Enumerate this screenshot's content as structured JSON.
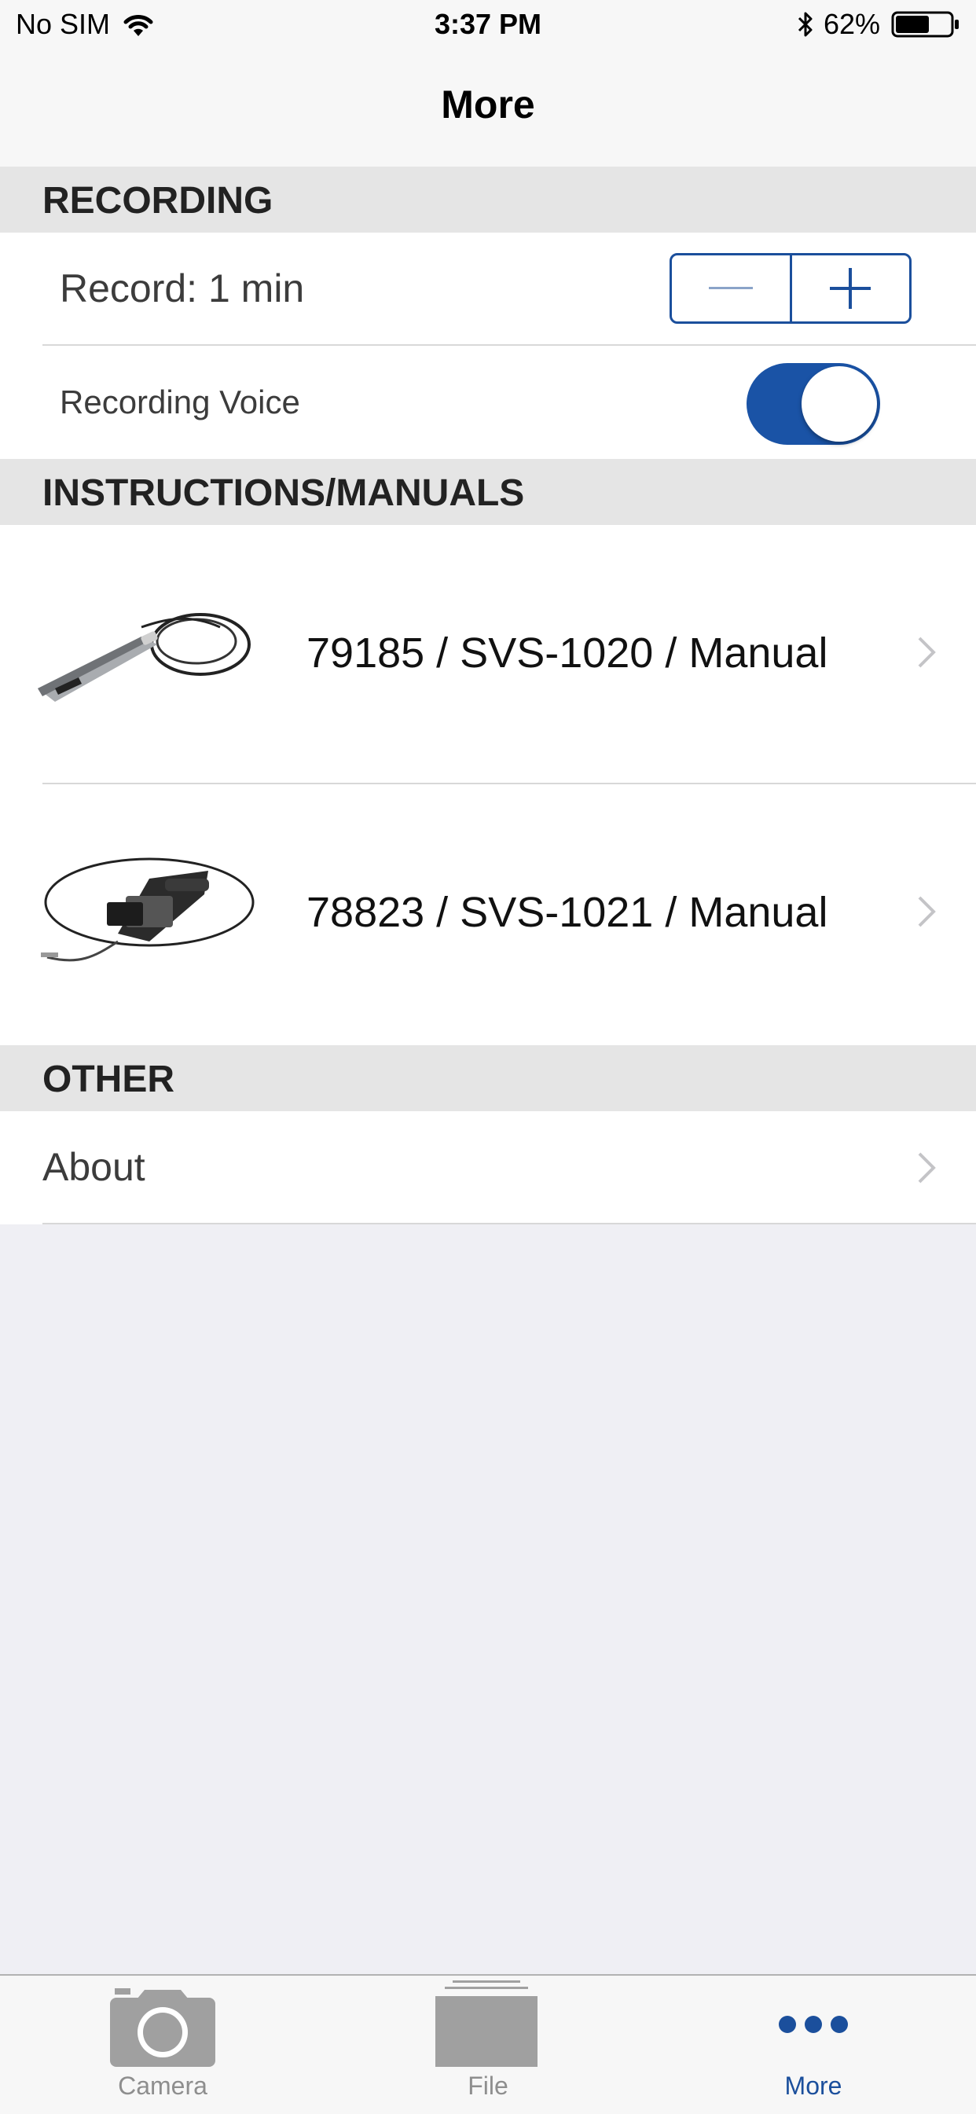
{
  "status_bar": {
    "carrier": "No SIM",
    "time": "3:37 PM",
    "battery": "62%",
    "battery_level": 0.62,
    "icons": [
      "wifi-icon",
      "bluetooth-icon",
      "battery-icon"
    ]
  },
  "nav": {
    "title": "More"
  },
  "recording": {
    "header": "RECORDING",
    "record_label": "Record: 1 min",
    "voice_label": "Recording Voice",
    "voice_enabled": true
  },
  "manuals": {
    "header": "INSTRUCTIONS/MANUALS",
    "items": [
      {
        "label": "79185 / SVS-1020 / Manual",
        "icon": "borescope-icon"
      },
      {
        "label": "78823 / SVS-1021 / Manual",
        "icon": "inspection-camera-icon"
      }
    ]
  },
  "other": {
    "header": "OTHER",
    "items": [
      {
        "label": "About"
      }
    ]
  },
  "tabs": [
    {
      "label": "Camera",
      "icon": "camera-icon",
      "active": false
    },
    {
      "label": "File",
      "icon": "file-icon",
      "active": false
    },
    {
      "label": "More",
      "icon": "more-icon",
      "active": true
    }
  ],
  "colors": {
    "accent": "#1b4f9c",
    "toggle_on": "#1a53a6",
    "background": "#efeff4",
    "section_bg": "#e5e5e5"
  }
}
